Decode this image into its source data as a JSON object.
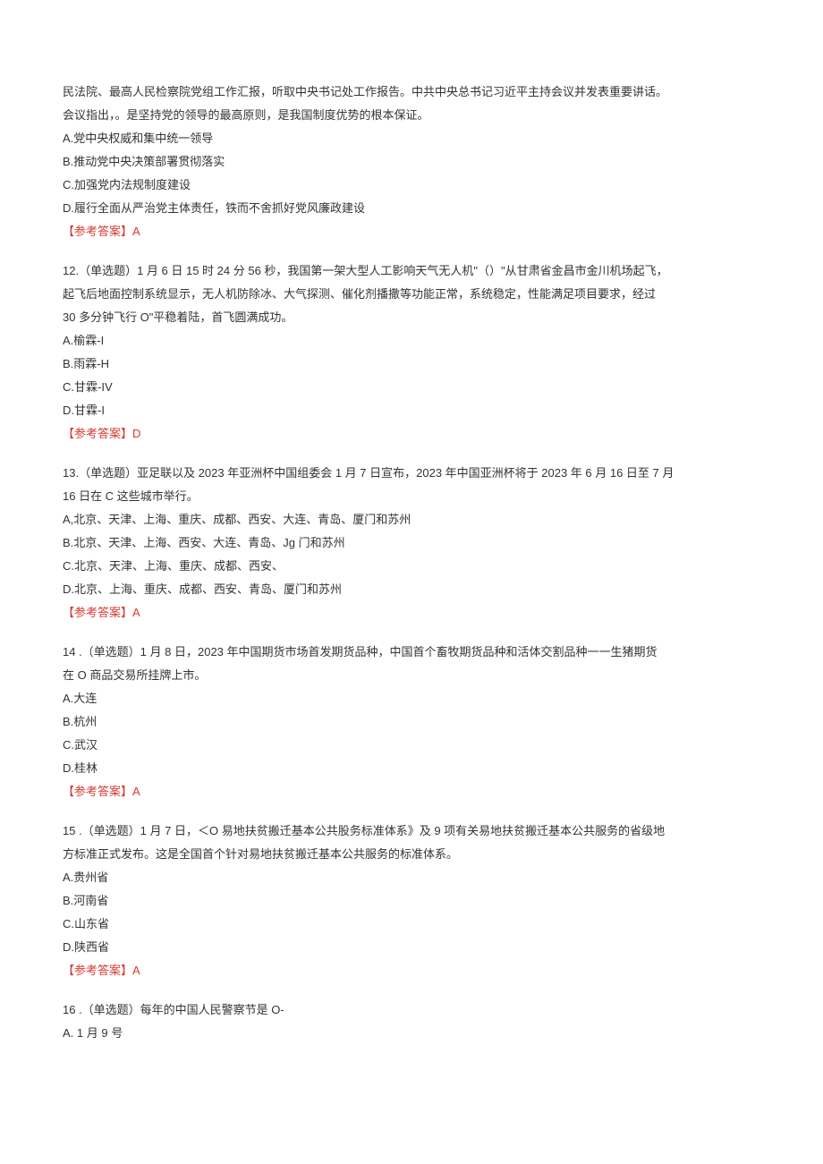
{
  "lead_in": {
    "l1": "民法院、最高人民检察院党组工作汇报，听取中央书记处工作报告。中共中央总书记习近平主持会议并发表重要讲话。",
    "l2": "会议指出，。是坚持党的领导的最高原则，是我国制度优势的根本保证。",
    "opts": {
      "a": "A.党中央权威和集中统一领导",
      "b": "B.推动党中央决策部署贯彻落实",
      "c": "C.加强党内法规制度建设",
      "d": "D.履行全面从严治党主体责任，铁而不舍抓好党风廉政建设"
    },
    "ans_label": "【参考答案】",
    "ans_value": "A"
  },
  "q12": {
    "stem1": "12.（单选题）1 月 6 日 15 时 24 分 56 秒，我国第一架大型人工影响天气无人机\"（）\"从甘肃省金昌市金川机场起飞，",
    "stem2": "起飞后地面控制系统显示，无人机防除冰、大气探测、催化剂播撒等功能正常，系统稳定，性能满足项目要求，经过",
    "stem3": "30 多分钟飞行 O\"平稳着陆，首飞圆满成功。",
    "opts": {
      "a": "A.榆霖-I",
      "b": "B.雨霖-H",
      "c": "C.甘霖-IV",
      "d": "D.甘霖-I"
    },
    "ans_label": "【参考答案】",
    "ans_value": "D"
  },
  "q13": {
    "stem1": "13.（单选题）亚足联以及 2023 年亚洲杯中国组委会 1 月 7 日宣布，2023 年中国亚洲杯将于 2023 年 6 月 16 日至 7 月",
    "stem2": "16 日在 C 这些城市举行。",
    "opts": {
      "a": "A,北京、天津、上海、重庆、成都、西安、大连、青岛、厦门和苏州",
      "b": "B.北京、天津、上海、西安、大连、青岛、Jg 门和苏州",
      "c": "C.北京、天津、上海、重庆、成都、西安、",
      "d": "D.北京、上海、重庆、成都、西安、青岛、厦门和苏州"
    },
    "ans_label": "【参考答案】",
    "ans_value": "A"
  },
  "q14": {
    "stem1": "14  .（单选题）1 月 8 日，2023 年中国期货市场首发期货品种，中国首个畜牧期货品种和活体交割品种一一生猪期货",
    "stem2": "在 O 商品交易所挂牌上市。",
    "opts": {
      "a": "A.大连",
      "b": "B.杭州",
      "c": "C.武汉",
      "d": "D.桂林"
    },
    "ans_label": "【参考答案】",
    "ans_value": "A"
  },
  "q15": {
    "stem1": "15  .（单选题）1 月 7 日，＜O 易地扶贫搬迁基本公共股务标准体系》及 9 项有关易地扶贫搬迁基本公共服务的省级地",
    "stem2": "方标准正式发布。这是全国首个针对易地扶贫搬迁基本公共服务的标准体系。",
    "opts": {
      "a": "A.贵州省",
      "b": "B.河南省",
      "c": "C.山东省",
      "d": "D.陕西省"
    },
    "ans_label": "【参考答案】",
    "ans_value": "A"
  },
  "q16": {
    "stem1": "16  .（单选题）每年的中国人民警察节是 O-",
    "opt_a": "A.   1 月 9 号"
  }
}
